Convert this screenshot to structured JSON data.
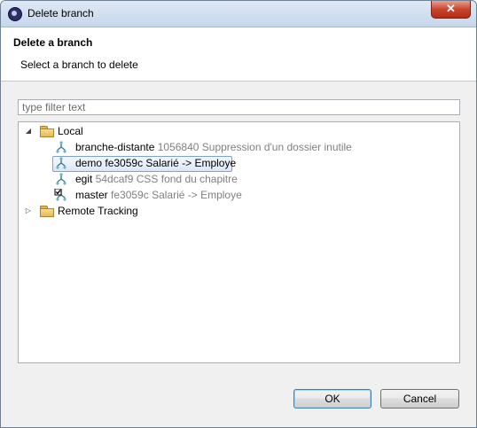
{
  "window": {
    "title": "Delete branch",
    "close_symbol": "✕"
  },
  "header": {
    "title": "Delete a branch",
    "subtitle": "Select a branch to delete"
  },
  "filter": {
    "placeholder": "type filter text",
    "value": ""
  },
  "tree": {
    "local": {
      "label": "Local",
      "expanded": true,
      "icon": "folder-open-icon",
      "branches": [
        {
          "name": "branche-distante",
          "meta": "1056840 Suppression d'un dossier inutile",
          "selected": false,
          "checked_out": false
        },
        {
          "name": "demo",
          "meta": "fe3059c Salarié -> Employe",
          "selected": true,
          "checked_out": false
        },
        {
          "name": "egit",
          "meta": "54dcaf9 CSS fond du chapitre",
          "selected": false,
          "checked_out": false
        },
        {
          "name": "master",
          "meta": "fe3059c Salarié -> Employe",
          "selected": false,
          "checked_out": true
        }
      ]
    },
    "remote": {
      "label": "Remote Tracking",
      "expanded": false,
      "icon": "folder-icon"
    }
  },
  "buttons": {
    "ok": "OK",
    "cancel": "Cancel"
  },
  "colors": {
    "selection_border": "#7da2ce",
    "meta_text": "#808080",
    "close_button": "#c8452e"
  }
}
